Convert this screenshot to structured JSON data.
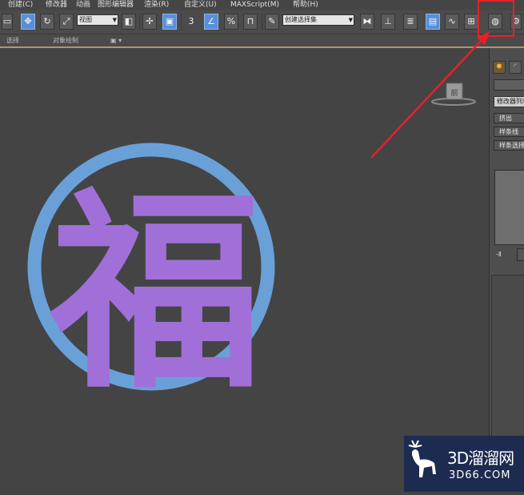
{
  "menu": [
    {
      "label": "创建(C)"
    },
    {
      "label": "修改器"
    },
    {
      "label": "动画"
    },
    {
      "label": "图形编辑器"
    },
    {
      "label": "渲染(R)"
    },
    {
      "label": "自定义(U)"
    },
    {
      "label": "MAXScript(M)"
    },
    {
      "label": "帮助(H)"
    }
  ],
  "toolbar": {
    "view_dropdown": "视图",
    "snap_label": "3",
    "selection_set_placeholder": "创建选择集",
    "icons": [
      "select-region-icon",
      "move-icon",
      "rotate-icon",
      "scale-icon",
      "pivot-icon",
      "manipulate-icon",
      "snap-icon",
      "angle-snap-icon",
      "percent-snap-icon",
      "spinner-snap-icon",
      "edit-named-selection-icon",
      "mirror-icon",
      "align-icon",
      "layer-icon",
      "scene-explorer-icon",
      "curve-editor-icon",
      "schematic-view-icon",
      "material-editor-icon",
      "render-setup-icon"
    ]
  },
  "subtoolbar": {
    "select_label": "选择",
    "object_paint_label": "对象绘制"
  },
  "viewport": {
    "viewcube_label": "前",
    "shape_text": "福"
  },
  "command_panel": {
    "modifier_list": "修改器列表",
    "rollout_extrude": "挤出",
    "rollout_spline": "样条线",
    "rollout_patch": "样条选择",
    "pin_label": "-Ⅱ"
  },
  "annotation": {
    "highlight_color": "#e8202a",
    "arrow_color": "#e8202a"
  },
  "watermark": {
    "brand": "3D溜溜网",
    "url": "3D66.COM"
  },
  "colors": {
    "ring": "#6aa0d8",
    "glyph": "#a070d8",
    "viewport_bg": "#444444",
    "active_button": "#5a8fd6"
  }
}
